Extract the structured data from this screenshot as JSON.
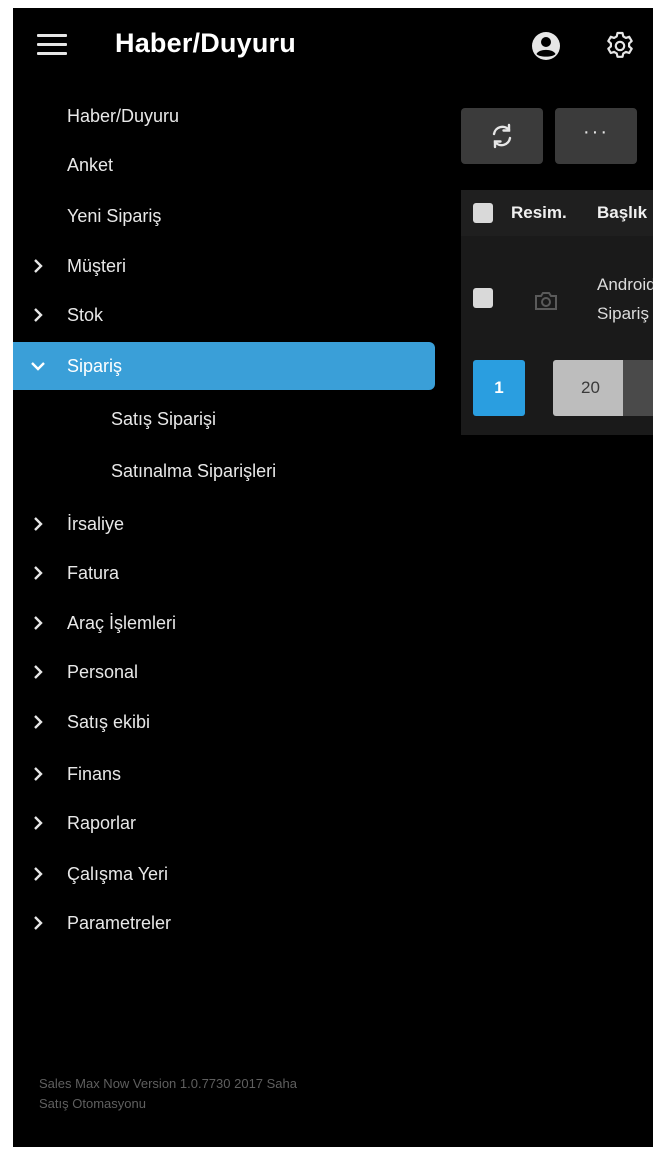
{
  "header": {
    "title": "Haber/Duyuru",
    "menu_icon": "hamburger-icon",
    "user_icon": "account-circle-icon",
    "settings_icon": "gear-icon"
  },
  "menu": {
    "active_color": "#3a9fd8",
    "items": [
      {
        "label": "Haber/Duyuru",
        "chevron": "none"
      },
      {
        "label": "Anket",
        "chevron": "none"
      },
      {
        "label": "Yeni Sipariş",
        "chevron": "none"
      },
      {
        "label": "Müşteri",
        "chevron": "right"
      },
      {
        "label": "Stok",
        "chevron": "right"
      },
      {
        "label": "Sipariş",
        "chevron": "down",
        "active": true
      },
      {
        "label": "Satış Siparişi",
        "chevron": "none",
        "sub": true
      },
      {
        "label": "Satınalma Siparişleri",
        "chevron": "none",
        "sub": true
      },
      {
        "label": "İrsaliye",
        "chevron": "right"
      },
      {
        "label": "Fatura",
        "chevron": "right"
      },
      {
        "label": "Araç İşlemleri",
        "chevron": "right"
      },
      {
        "label": "Personal",
        "chevron": "right"
      },
      {
        "label": "Satış ekibi",
        "chevron": "right"
      },
      {
        "label": "Finans",
        "chevron": "right"
      },
      {
        "label": "Raporlar",
        "chevron": "right"
      },
      {
        "label": "Çalışma Yeri",
        "chevron": "right"
      },
      {
        "label": "Parametreler",
        "chevron": "right"
      }
    ]
  },
  "footer": {
    "line1": "Sales Max Now Version 1.0.7730 2017 Saha",
    "line2": "Satış Otomasyonu"
  },
  "content": {
    "refresh_icon": "refresh-icon",
    "more_label": "···",
    "grid": {
      "columns": [
        "Resim.",
        "Başlık"
      ],
      "rows": [
        {
          "image_icon": "camera-icon",
          "title_line1": "Android",
          "title_line2": "Sipariş"
        }
      ]
    },
    "pager": {
      "current_page": "1",
      "page_size": "20",
      "accent": "#2a9ee0"
    }
  }
}
